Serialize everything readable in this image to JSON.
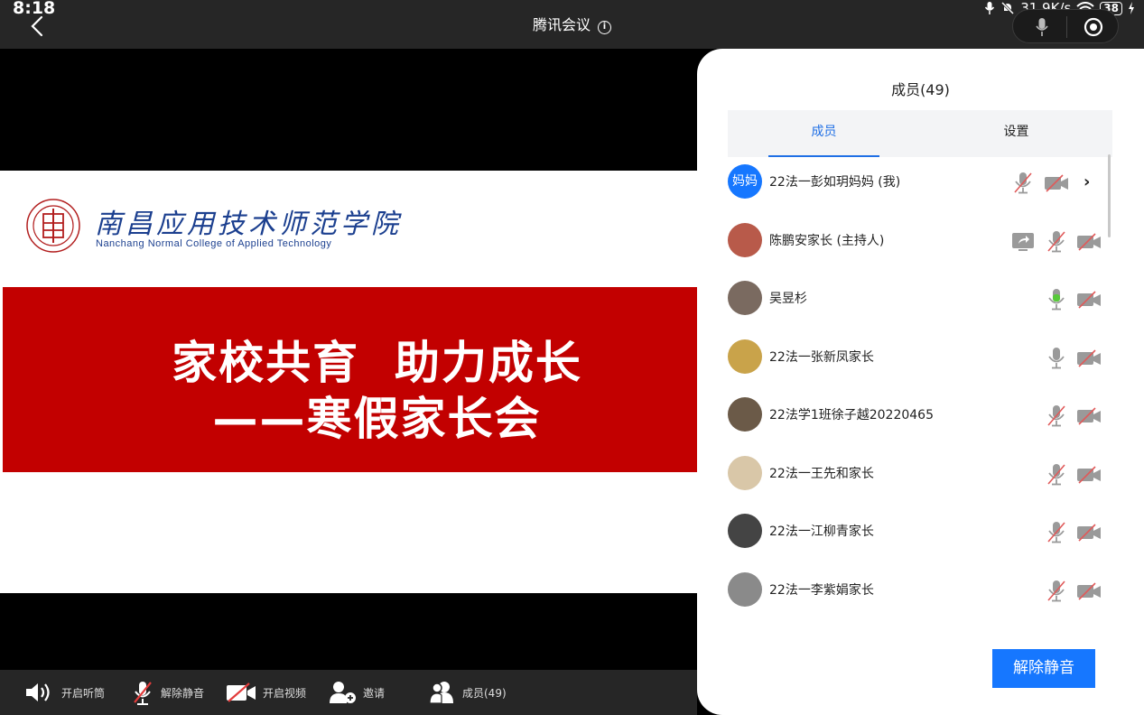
{
  "status_bar": {
    "time": "8:18",
    "net_speed": "31.9K/s",
    "battery": "38"
  },
  "header": {
    "title": "腾讯会议",
    "info_icon": "info-icon"
  },
  "slide": {
    "college_cn": "南昌应用技术师范学院",
    "college_en": "Nanchang Normal College of Applied Technology",
    "headline": "家校共育  助力成长",
    "subline": "——寒假家长会"
  },
  "toolbar": {
    "speaker": "开启听筒",
    "unmute": "解除静音",
    "video": "开启视频",
    "invite": "邀请",
    "members": "成员(49)"
  },
  "panel": {
    "title": "成员(49)",
    "tabs": [
      "成员",
      "设置"
    ],
    "unmute_button": "解除静音",
    "members": [
      {
        "name": "22法一彭如玥妈妈 (我)",
        "avatar_text": "妈妈",
        "avatar_color": "#1677ff",
        "mic": "muted",
        "video": "off",
        "sharing": false,
        "chevron": true
      },
      {
        "name": "陈鹏安家长 (主持人)",
        "avatar_text": "",
        "avatar_color": "#b85a4a",
        "mic": "muted",
        "video": "off",
        "sharing": true,
        "chevron": false
      },
      {
        "name": "吴昱杉",
        "avatar_text": "",
        "avatar_color": "#7a6a60",
        "mic": "speaking",
        "video": "off",
        "sharing": false,
        "chevron": false
      },
      {
        "name": "22法一张新凤家长",
        "avatar_text": "",
        "avatar_color": "#c9a34a",
        "mic": "on",
        "video": "off",
        "sharing": false,
        "chevron": false
      },
      {
        "name": "22法学1班徐子越20220465",
        "avatar_text": "",
        "avatar_color": "#6b5a48",
        "mic": "muted",
        "video": "off",
        "sharing": false,
        "chevron": false
      },
      {
        "name": "22法一王先和家长",
        "avatar_text": "",
        "avatar_color": "#d9c7a8",
        "mic": "muted",
        "video": "off",
        "sharing": false,
        "chevron": false
      },
      {
        "name": "22法一江柳青家长",
        "avatar_text": "",
        "avatar_color": "#444444",
        "mic": "muted",
        "video": "off",
        "sharing": false,
        "chevron": false
      },
      {
        "name": "22法一李紫娟家长",
        "avatar_text": "",
        "avatar_color": "#8a8a8a",
        "mic": "muted",
        "video": "off",
        "sharing": false,
        "chevron": false
      }
    ]
  }
}
